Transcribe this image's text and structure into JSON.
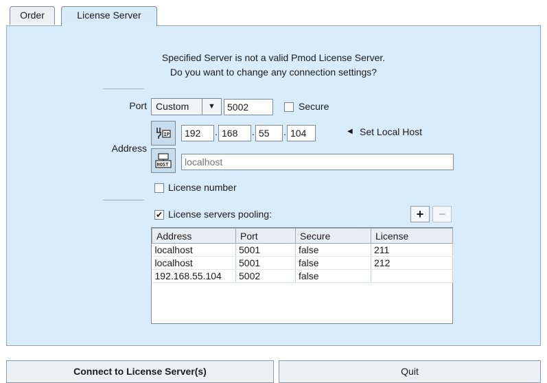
{
  "tabs": [
    {
      "label": "Order"
    },
    {
      "label": "License Server"
    }
  ],
  "message": {
    "line1": "Specified Server is not a valid Pmod License Server.",
    "line2": "Do you want to change any connection settings?"
  },
  "port": {
    "label": "Port",
    "mode": "Custom",
    "value": "5002",
    "secure_label": "Secure",
    "secure_checked": false
  },
  "address": {
    "label": "Address",
    "ip": [
      "192",
      "168",
      "55",
      "104"
    ],
    "set_local_host_label": "Set Local Host",
    "host_placeholder": "localhost"
  },
  "license_number": {
    "label": "License number",
    "checked": false
  },
  "pooling": {
    "label": "License servers pooling:",
    "checked": true,
    "add_label": "+",
    "remove_label": "−",
    "columns": [
      "Address",
      "Port",
      "Secure",
      "License"
    ],
    "rows": [
      [
        "localhost",
        "5001",
        "false",
        "211"
      ],
      [
        "localhost",
        "5001",
        "false",
        "212"
      ],
      [
        "192.168.55.104",
        "5002",
        "false",
        ""
      ]
    ]
  },
  "buttons": {
    "connect": "Connect to License Server(s)",
    "quit": "Quit"
  }
}
